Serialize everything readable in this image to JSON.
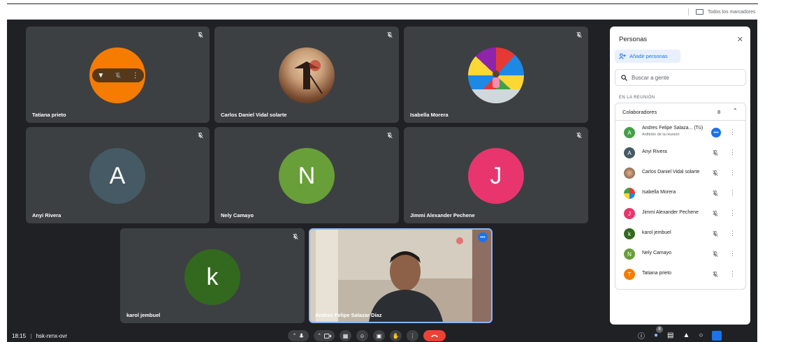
{
  "bookmarks": {
    "all_bookmarks": "Todos los marcadores"
  },
  "tiles": [
    {
      "name": "Tatiana prieto"
    },
    {
      "name": "Carlos Daniel Vidal solarte"
    },
    {
      "name": "Isabella Morera"
    },
    {
      "name": "Anyi Rivera",
      "initial": "A"
    },
    {
      "name": "Nely Camayo",
      "initial": "N"
    },
    {
      "name": "Jimmi Alexander Pechene",
      "initial": "J"
    },
    {
      "name": "karol jembuel",
      "initial": "k"
    },
    {
      "name": "Andres Felipe Salazar Díaz"
    }
  ],
  "colors": {
    "tatiana": "#f57c00",
    "anyi": "#455a64",
    "nely": "#689f38",
    "jimmi": "#e8356d",
    "karol": "#33691e",
    "andres": "#43a047",
    "accent": "#1a73e8",
    "hangup": "#ea4335"
  },
  "bottom": {
    "time": "18:15",
    "separator": "|",
    "meeting_code": "hsk-nrnx-ovr",
    "people_count": "8"
  },
  "panel": {
    "title": "Personas",
    "add_people": "Añadir personas",
    "search_placeholder": "Buscar a gente",
    "section": "EN LA REUNIÓN",
    "group": "Colaboradores",
    "group_count": "8",
    "people": [
      {
        "name": "Andres Felipe Salaza... (Tú)",
        "sub": "Anfitrión de la reunión",
        "initial": "A"
      },
      {
        "name": "Anyi Rivera",
        "initial": "A"
      },
      {
        "name": "Carlos Daniel Vidal solarte"
      },
      {
        "name": "Isabella Morera"
      },
      {
        "name": "Jimmi Alexander Pechene",
        "initial": "J"
      },
      {
        "name": "karol jembuel",
        "initial": "k"
      },
      {
        "name": "Nely Camayo",
        "initial": "N"
      },
      {
        "name": "Tatiana prieto",
        "initial": "T"
      }
    ]
  },
  "icons": [
    "mic-off-icon",
    "pin-icon",
    "more-vert-icon",
    "mic-icon",
    "camera-icon",
    "captions-icon",
    "emoji-icon",
    "present-icon",
    "raise-hand-icon",
    "call-end-icon",
    "info-icon",
    "people-icon",
    "chat-icon",
    "activities-icon",
    "lock-icon",
    "search-icon",
    "close-icon",
    "add-person-icon",
    "folder-icon"
  ]
}
